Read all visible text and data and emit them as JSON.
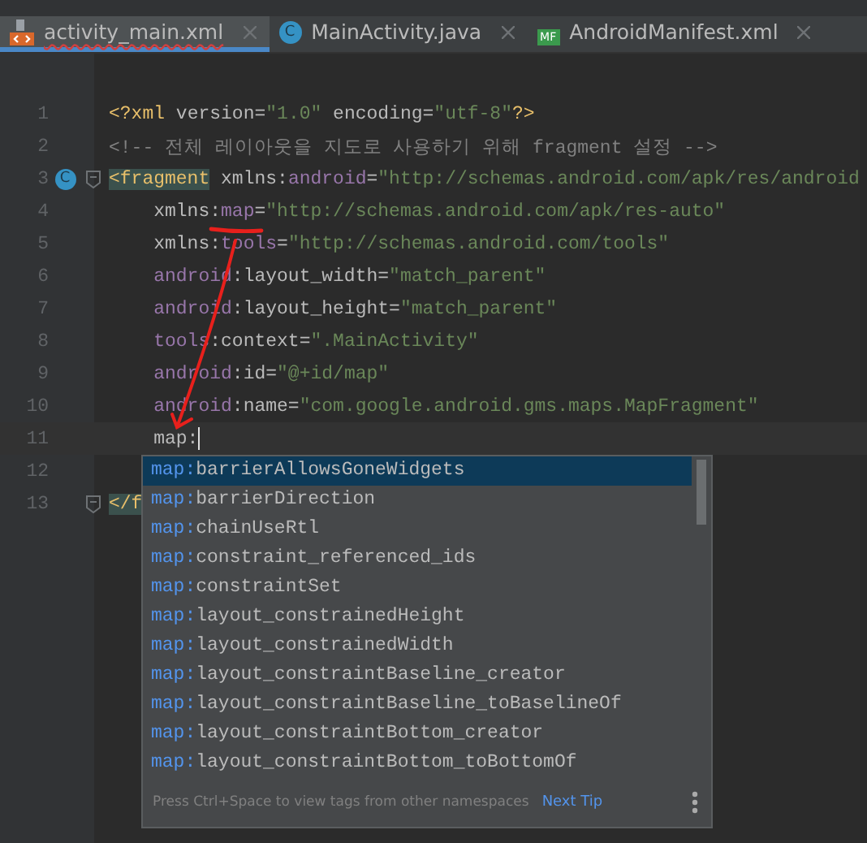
{
  "tabs": [
    {
      "label": "activity_main.xml",
      "kind": "xml",
      "selected": true,
      "error": true
    },
    {
      "label": "MainActivity.java",
      "kind": "class",
      "badge": "C",
      "selected": false,
      "error": false
    },
    {
      "label": "AndroidManifest.xml",
      "kind": "manifest",
      "badge": "MF",
      "selected": false,
      "error": false
    }
  ],
  "editor": {
    "lines": [
      {
        "number": "1",
        "tokens": [
          {
            "text": "<?xml ",
            "kind": "tag"
          },
          {
            "text": "version=",
            "kind": "attr"
          },
          {
            "text": "\"1.0\"",
            "kind": "string"
          },
          {
            "text": " encoding=",
            "kind": "attr"
          },
          {
            "text": "\"utf-8\"",
            "kind": "string"
          },
          {
            "text": "?>",
            "kind": "tag"
          }
        ]
      },
      {
        "number": "2",
        "tokens": [
          {
            "text": "<!-- 전체 레이아웃을 지도로 사용하기 위해 fragment 설정 -->",
            "kind": "comment"
          }
        ]
      },
      {
        "number": "3",
        "gutter_badge": "C",
        "fold": true,
        "tokens": [
          {
            "text": "<fragment",
            "kind": "tag",
            "highlighted": true
          },
          {
            "text": " xmlns:",
            "kind": "attr"
          },
          {
            "text": "android",
            "kind": "ns"
          },
          {
            "text": "=",
            "kind": "attr"
          },
          {
            "text": "\"http://schemas.android.com/apk/res/android",
            "kind": "string"
          }
        ]
      },
      {
        "number": "4",
        "tokens": [
          {
            "text": "    xmlns:",
            "kind": "attr"
          },
          {
            "text": "map",
            "kind": "ns"
          },
          {
            "text": "=",
            "kind": "attr"
          },
          {
            "text": "\"http://schemas.android.com/apk/res-auto\"",
            "kind": "string"
          }
        ]
      },
      {
        "number": "5",
        "tokens": [
          {
            "text": "    xmlns:",
            "kind": "attr"
          },
          {
            "text": "tools",
            "kind": "ns"
          },
          {
            "text": "=",
            "kind": "attr"
          },
          {
            "text": "\"http://schemas.android.com/tools\"",
            "kind": "string"
          }
        ]
      },
      {
        "number": "6",
        "tokens": [
          {
            "text": "    android",
            "kind": "ns"
          },
          {
            "text": ":layout_width=",
            "kind": "attr"
          },
          {
            "text": "\"match_parent\"",
            "kind": "string"
          }
        ]
      },
      {
        "number": "7",
        "tokens": [
          {
            "text": "    android",
            "kind": "ns"
          },
          {
            "text": ":layout_height=",
            "kind": "attr"
          },
          {
            "text": "\"match_parent\"",
            "kind": "string"
          }
        ]
      },
      {
        "number": "8",
        "tokens": [
          {
            "text": "    tools",
            "kind": "ns"
          },
          {
            "text": ":context=",
            "kind": "attr"
          },
          {
            "text": "\".MainActivity\"",
            "kind": "string"
          }
        ]
      },
      {
        "number": "9",
        "tokens": [
          {
            "text": "    android",
            "kind": "ns"
          },
          {
            "text": ":id=",
            "kind": "attr"
          },
          {
            "text": "\"@+id/map\"",
            "kind": "string"
          }
        ]
      },
      {
        "number": "10",
        "tokens": [
          {
            "text": "    android",
            "kind": "ns"
          },
          {
            "text": ":name=",
            "kind": "attr"
          },
          {
            "text": "\"com.google.android.gms.maps.MapFragment\"",
            "kind": "string"
          }
        ]
      },
      {
        "number": "11",
        "current": true,
        "caret": true,
        "tokens": [
          {
            "text": "    map:",
            "kind": "attr"
          }
        ]
      },
      {
        "number": "12"
      },
      {
        "number": "13",
        "fold": true,
        "tokens": [
          {
            "text": "</f",
            "kind": "tag",
            "highlighted": true
          }
        ]
      }
    ]
  },
  "completion": {
    "items": [
      {
        "prefix": "map:",
        "name": "barrierAllowsGoneWidgets",
        "selected": true
      },
      {
        "prefix": "map:",
        "name": "barrierDirection",
        "selected": false
      },
      {
        "prefix": "map:",
        "name": "chainUseRtl",
        "selected": false
      },
      {
        "prefix": "map:",
        "name": "constraint_referenced_ids",
        "selected": false
      },
      {
        "prefix": "map:",
        "name": "constraintSet",
        "selected": false
      },
      {
        "prefix": "map:",
        "name": "layout_constrainedHeight",
        "selected": false
      },
      {
        "prefix": "map:",
        "name": "layout_constrainedWidth",
        "selected": false
      },
      {
        "prefix": "map:",
        "name": "layout_constraintBaseline_creator",
        "selected": false
      },
      {
        "prefix": "map:",
        "name": "layout_constraintBaseline_toBaselineOf",
        "selected": false
      },
      {
        "prefix": "map:",
        "name": "layout_constraintBottom_creator",
        "selected": false
      },
      {
        "prefix": "map:",
        "name": "layout_constraintBottom_toBottomOf",
        "selected": false
      }
    ],
    "hint": "Press Ctrl+Space to view tags from other namespaces",
    "link": "Next Tip"
  }
}
